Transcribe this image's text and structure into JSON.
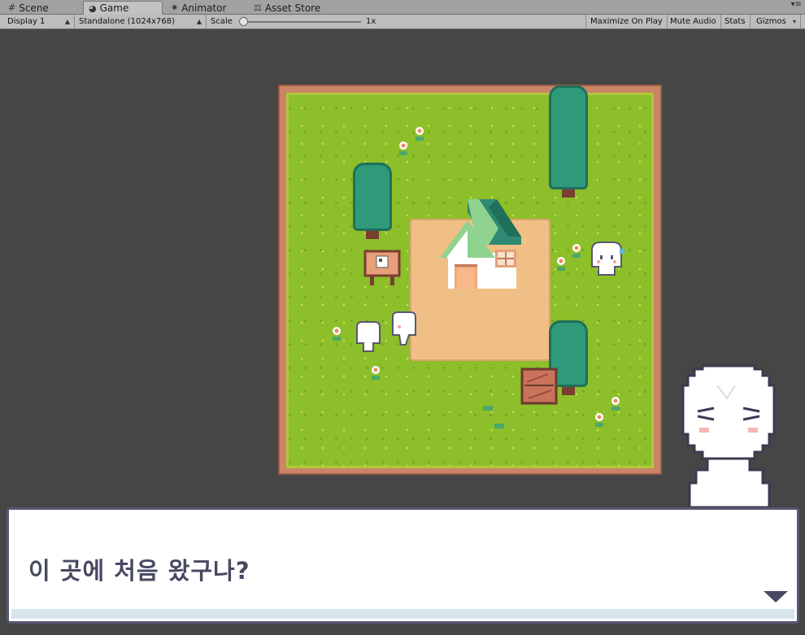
{
  "tabs": [
    {
      "label": "Scene",
      "icon": "grid-icon",
      "active": false
    },
    {
      "label": "Game",
      "icon": "game-icon",
      "active": true
    },
    {
      "label": "Animator",
      "icon": "animator-icon",
      "active": false
    },
    {
      "label": "Asset Store",
      "icon": "store-icon",
      "active": false
    }
  ],
  "toolbar": {
    "display": "Display 1",
    "resolution": "Standalone (1024x768)",
    "scale_label": "Scale",
    "scale_value": "1x",
    "maximize": "Maximize On Play",
    "mute": "Mute Audio",
    "stats": "Stats",
    "gizmos": "Gizmos"
  },
  "dialog": {
    "text": "이 곳에 처음 왔구나?"
  },
  "colors": {
    "grass": "#8cbf2a",
    "dirt": "#f0bf86",
    "frame": "#c98565",
    "roof": "#2f9a7a",
    "dialog_text": "#484a63"
  }
}
